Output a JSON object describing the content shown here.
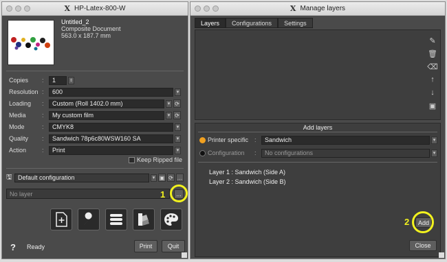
{
  "left_window": {
    "title": "HP-Latex-800-W",
    "doc_name": "Untitled_2",
    "doc_type": "Composite Document",
    "doc_size": "563.0 x 187.7 mm",
    "fields": [
      {
        "label": "Copies",
        "value": "1"
      },
      {
        "label": "Resolution",
        "value": "600"
      },
      {
        "label": "Loading",
        "value": "Custom (Roll 1402.0 mm)"
      },
      {
        "label": "Media",
        "value": "My custom film"
      },
      {
        "label": "Mode",
        "value": "CMYK8"
      },
      {
        "label": "Quality",
        "value": "Sandwich 78p6c80WSW160 SA"
      },
      {
        "label": "Action",
        "value": "Print"
      }
    ],
    "keep_ripped_label": "Keep Ripped file",
    "configuration_value": "Default configuration",
    "layer_value": "No layer",
    "dots_label": "...",
    "status_text": "Ready",
    "help_label": "?",
    "print_label": "Print",
    "quit_label": "Quit",
    "callout_1": "1"
  },
  "right_window": {
    "title": "Manage layers",
    "tabs": [
      "Layers",
      "Configurations",
      "Settings"
    ],
    "add_layers_title": "Add layers",
    "printer_specific_label": "Printer specific",
    "printer_specific_value": "Sandwich",
    "configuration_label": "Configuration",
    "configuration_value": "No configurations",
    "layers": [
      "Layer 1 : Sandwich (Side A)",
      "Layer 2 : Sandwich (Side B)"
    ],
    "add_label": "Add",
    "close_label": "Close",
    "callout_2": "2"
  },
  "colors": {
    "accent_orange": "#f0a020",
    "callout_yellow": "#f2f21e"
  }
}
